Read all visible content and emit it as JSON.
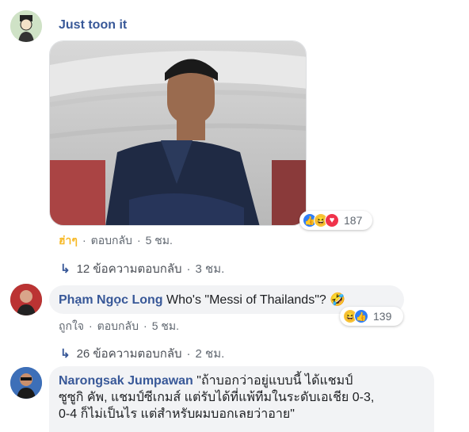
{
  "comments": [
    {
      "author": "Just toon it",
      "reaction_label": "ฮ่าๆ",
      "reply_action": "ตอบกลับ",
      "time": "5 ชม.",
      "reactions_count": "187",
      "replies_link": "12 ข้อความตอบกลับ",
      "replies_time": "3 ชม."
    },
    {
      "author": "Phạm Ngọc Long",
      "text": "Who's \"Messi of Thailands\"?",
      "emoji": "🤣",
      "like_action": "ถูกใจ",
      "reply_action": "ตอบกลับ",
      "time": "5 ชม.",
      "reactions_count": "139",
      "replies_link": "26 ข้อความตอบกลับ",
      "replies_time": "2 ชม."
    },
    {
      "author": "Narongsak Jumpawan",
      "text_line1": "\"ถ้าบอกว่าอยู่แบบนี้ ได้แชมป์",
      "text_line2": "ซูซูกิ คัพ, แชมป์ซีเกมส์ แต่รับได้ที่แพ้ทีมในระดับเอเชีย 0-3,",
      "text_line3": "0-4 ก็ไม่เป็นไร แต่สำหรับผมบอกเลยว่าอาย\""
    }
  ],
  "colors": {
    "link_blue": "#385898",
    "bubble_gray": "#f2f3f5",
    "haha_yellow": "#f7b928",
    "meta_gray": "#606770"
  },
  "icons": [
    "reply-arrow-icon",
    "like-reaction-icon",
    "haha-reaction-icon",
    "love-reaction-icon"
  ]
}
